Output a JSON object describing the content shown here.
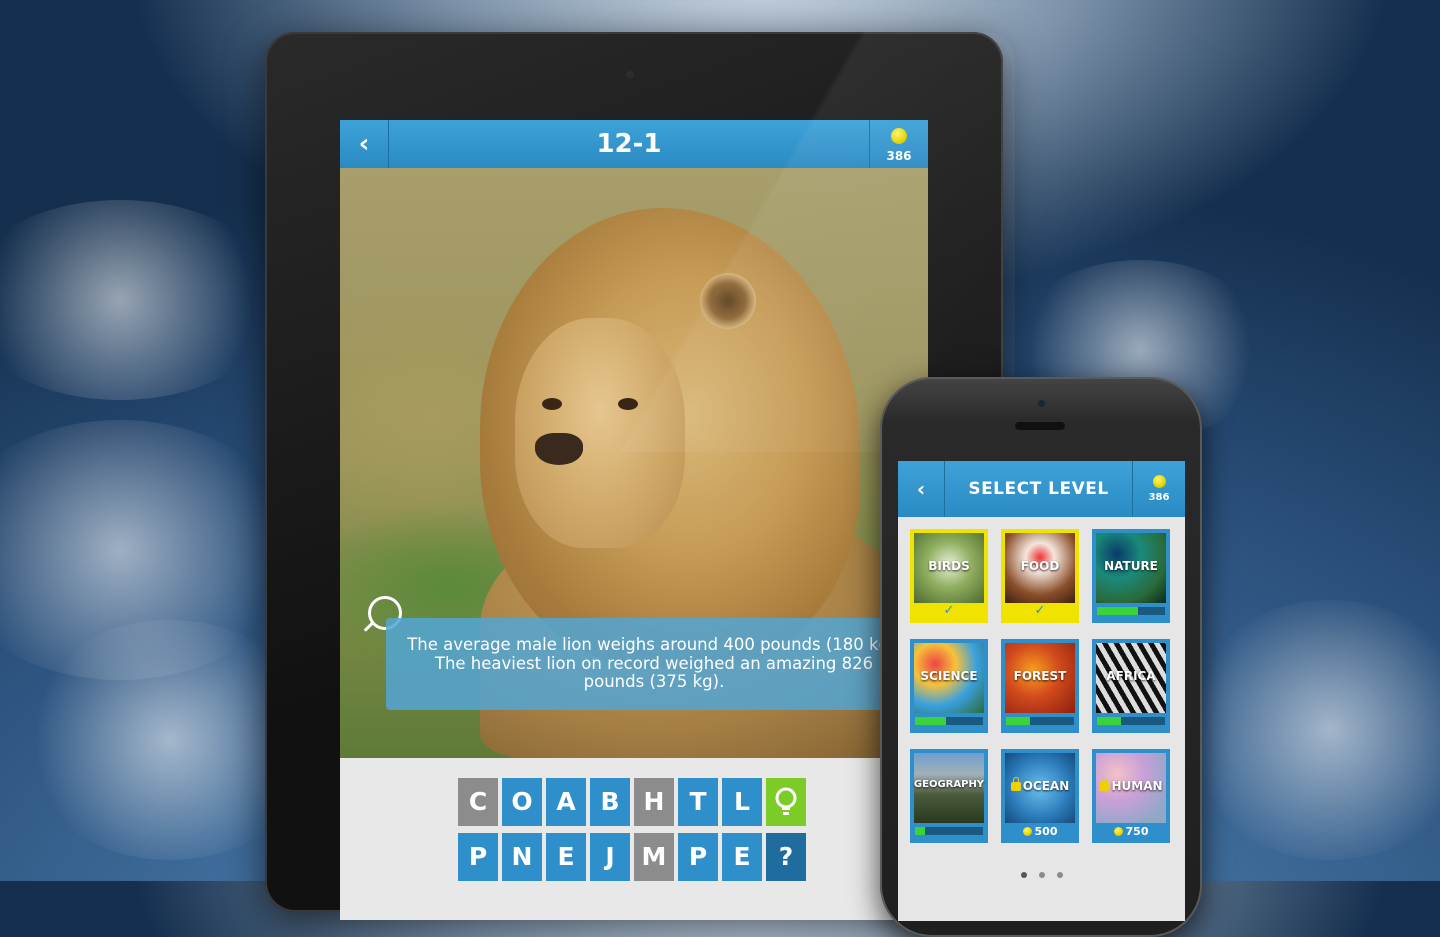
{
  "tablet": {
    "level_title": "12-1",
    "coins": "386",
    "fact_text": "The average male lion weighs around 400 pounds (180 kg). The heaviest lion on record weighed an amazing 826 pounds (375 kg).",
    "keys_row1": [
      "C",
      "O",
      "A",
      "B",
      "H",
      "T",
      "L"
    ],
    "keys_row2": [
      "P",
      "N",
      "E",
      "J",
      "M",
      "P",
      "E",
      "?"
    ]
  },
  "phone": {
    "title": "SELECT LEVEL",
    "coins": "386",
    "levels": [
      {
        "label": "BIRDS",
        "state": "completed"
      },
      {
        "label": "FOOD",
        "state": "completed"
      },
      {
        "label": "NATURE",
        "state": "in-progress",
        "progress": 0.6
      },
      {
        "label": "SCIENCE",
        "state": "in-progress",
        "progress": 0.45
      },
      {
        "label": "FOREST",
        "state": "in-progress",
        "progress": 0.35
      },
      {
        "label": "AFRICA",
        "state": "in-progress",
        "progress": 0.35
      },
      {
        "label": "GEOGRAPHY",
        "state": "in-progress",
        "progress": 0.15
      },
      {
        "label": "OCEAN",
        "state": "locked",
        "price": "500"
      },
      {
        "label": "HUMAN",
        "state": "locked",
        "price": "750"
      }
    ],
    "page_dots": 3,
    "active_page": 1
  },
  "colors": {
    "accent_blue": "#2e8fcb",
    "hint_green": "#7ccc27",
    "complete_yellow": "#f0e300",
    "progress_green": "#3ad33a",
    "coin_yellow": "#e4d300"
  },
  "icons": [
    "back-chevron-icon",
    "coin-icon",
    "magnifier-icon",
    "lightbulb-icon",
    "check-icon",
    "lock-icon"
  ]
}
